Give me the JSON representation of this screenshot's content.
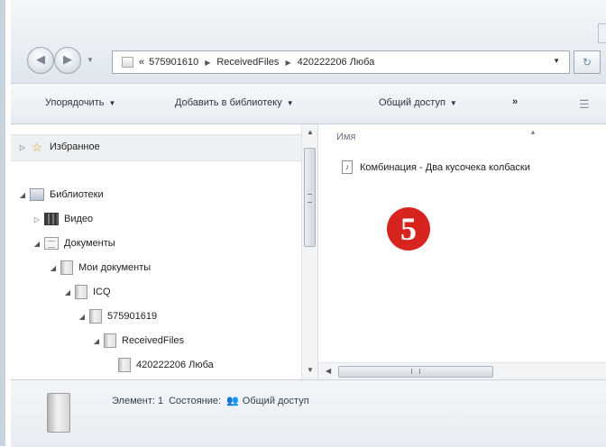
{
  "address_bar": {
    "overflow": "«",
    "segments": [
      "575901610",
      "ReceivedFiles",
      "420222206 Люба"
    ]
  },
  "toolbar": {
    "organize": "Упорядочить",
    "add_to_library": "Добавить в библиотеку",
    "share": "Общий доступ",
    "more": "»"
  },
  "nav_tree": {
    "favorites": "Избранное",
    "libraries": "Библиотеки",
    "video": "Видео",
    "documents": "Документы",
    "my_documents": "Мои документы",
    "icq": "ICQ",
    "account_folder": "575901619",
    "received": "ReceivedFiles",
    "contact": "420222206 Люба"
  },
  "content": {
    "column_name": "Имя",
    "files": [
      {
        "name": "Комбинация - Два кусочека колбаски",
        "icon": "music-file-icon"
      }
    ],
    "step_number": "5"
  },
  "details": {
    "items_label": "Элемент: 1",
    "state_label": "Состояние:",
    "state_value": "Общий доступ"
  },
  "colors": {
    "badge": "#d8241f",
    "chrome": "#e9eef4"
  }
}
